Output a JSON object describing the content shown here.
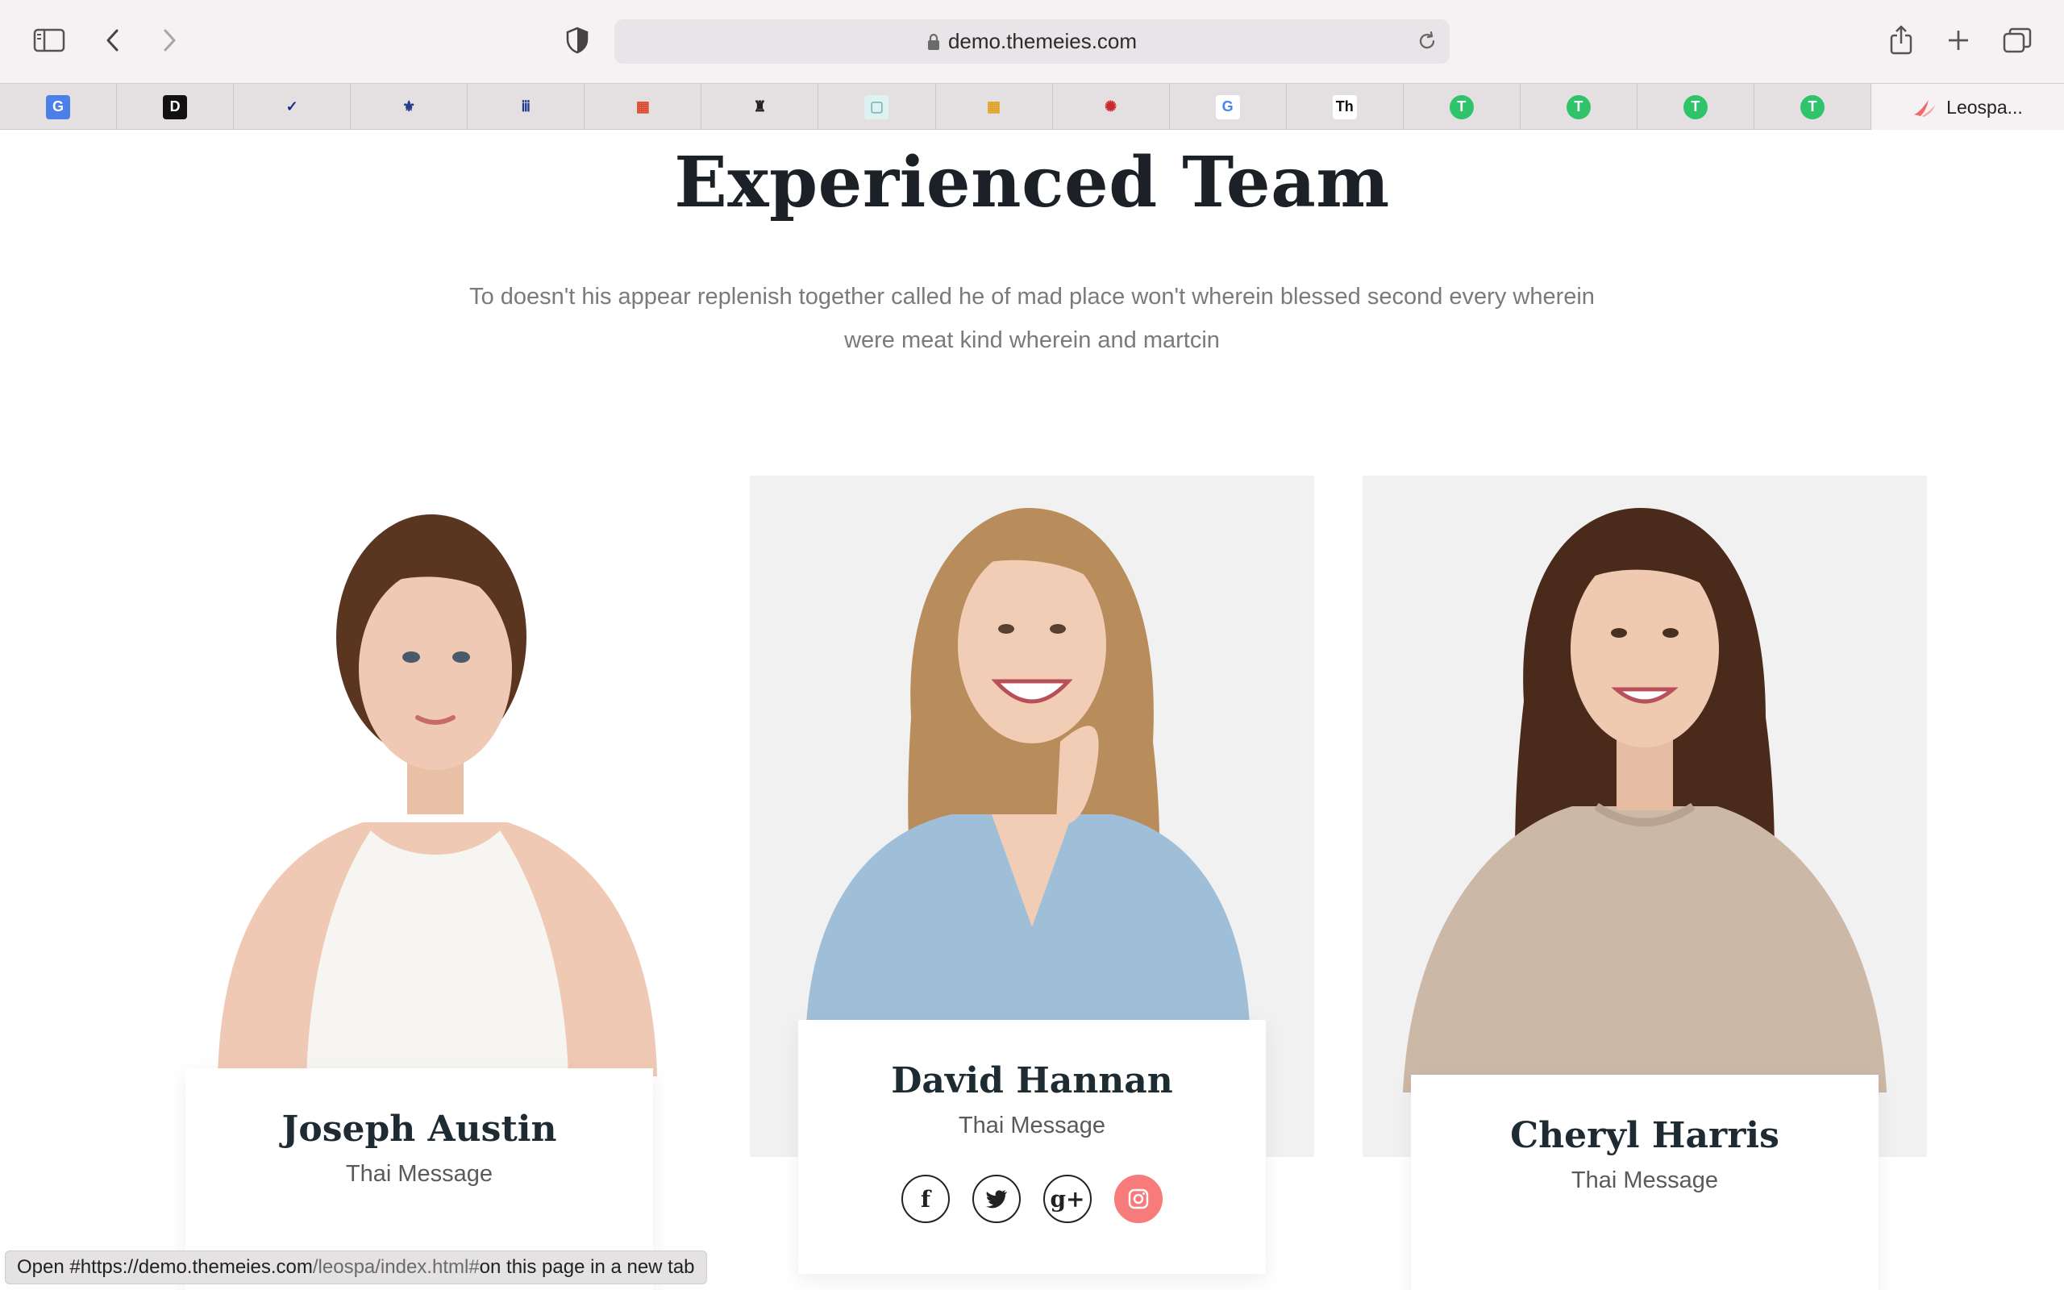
{
  "browser": {
    "url": "demo.themeies.com",
    "active_tab_label": "Leospa...",
    "favorites": [
      {
        "icon": "google-translate-icon",
        "glyph": "G",
        "bg": "#4a80e8",
        "fg": "#ffffff"
      },
      {
        "icon": "d-letter-icon",
        "glyph": "D",
        "bg": "#111111",
        "fg": "#ffffff"
      },
      {
        "icon": "checkmark-blue-icon",
        "glyph": "✓",
        "bg": "#e4e0e2",
        "fg": "#1a2a8a"
      },
      {
        "icon": "fleur-de-lis-icon",
        "glyph": "⚜",
        "bg": "#e4e0e2",
        "fg": "#1f3a8a"
      },
      {
        "icon": "columns-icon",
        "glyph": "ⅲ",
        "bg": "#e4e0e2",
        "fg": "#1f3a8a"
      },
      {
        "icon": "color-grid-icon",
        "glyph": "▦",
        "bg": "#e4e0e2",
        "fg": "#d9452b"
      },
      {
        "icon": "eagle-crest-icon",
        "glyph": "♜",
        "bg": "#e4e0e2",
        "fg": "#222222"
      },
      {
        "icon": "mbr-badge-icon",
        "glyph": "▢",
        "bg": "#dff2f2",
        "fg": "#7fb6c2"
      },
      {
        "icon": "color-grid-icon",
        "glyph": "▦",
        "bg": "#e4e0e2",
        "fg": "#e0a020"
      },
      {
        "icon": "brain-icon",
        "glyph": "✺",
        "bg": "#e4e0e2",
        "fg": "#c8282e"
      },
      {
        "icon": "google-icon",
        "glyph": "G",
        "bg": "#ffffff",
        "fg": "#4285f4"
      },
      {
        "icon": "th-logo-icon",
        "glyph": "Th",
        "bg": "#ffffff",
        "fg": "#111111"
      },
      {
        "icon": "green-t-icon",
        "glyph": "T",
        "bg": "#2fc46a",
        "fg": "#ffffff"
      },
      {
        "icon": "green-t-icon",
        "glyph": "T",
        "bg": "#2fc46a",
        "fg": "#ffffff"
      },
      {
        "icon": "green-t-icon",
        "glyph": "T",
        "bg": "#2fc46a",
        "fg": "#ffffff"
      },
      {
        "icon": "green-t-icon",
        "glyph": "T",
        "bg": "#2fc46a",
        "fg": "#ffffff"
      }
    ],
    "status_bar": {
      "prefix": "Open #",
      "host": "https://demo.themeies.com",
      "path": "/leospa/index.html#",
      "suffix": " on this page in a new tab"
    }
  },
  "section": {
    "title": "Experienced Team",
    "subtitle": "To doesn't his appear replenish together called he of mad place won't wherein blessed second every wherein were meat kind wherein and martcin"
  },
  "team": [
    {
      "name": "Joseph Austin",
      "role": "Thai Message",
      "hair": "#5a3520",
      "top": "#f7f5f2",
      "skin": "#efc9b3"
    },
    {
      "name": "David Hannan",
      "role": "Thai Message",
      "hair": "#b98d5b",
      "top": "#9fbfd9",
      "skin": "#f2cdb6"
    },
    {
      "name": "Cheryl Harris",
      "role": "Thai Message",
      "hair": "#4a2a1b",
      "top": "#cbb8a6",
      "skin": "#f0c9b1"
    }
  ],
  "social": [
    {
      "icon": "facebook-icon",
      "glyph": "f"
    },
    {
      "icon": "twitter-icon",
      "glyph": "t"
    },
    {
      "icon": "google-plus-icon",
      "glyph": "g+"
    },
    {
      "icon": "instagram-icon",
      "glyph": "◎"
    }
  ],
  "colors": {
    "accent": "#f87b7b",
    "title": "#1b2127",
    "subtitle": "#7a7a7a"
  }
}
